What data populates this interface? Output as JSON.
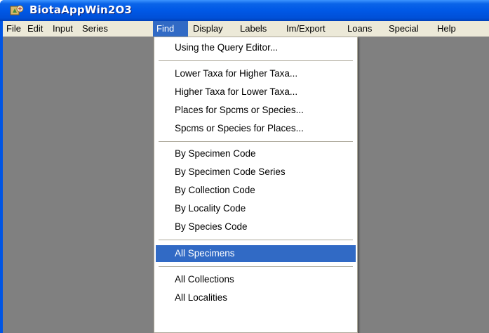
{
  "window": {
    "title": "BiotaAppWin2O3"
  },
  "menubar": {
    "items": [
      "File",
      "Edit",
      "Input",
      "Series",
      "Find",
      "Display",
      "Labels",
      "Im/Export",
      "Loans",
      "Special",
      "Help"
    ],
    "active": "Find"
  },
  "find_menu": {
    "groups": [
      [
        "Using the Query Editor..."
      ],
      [
        "Lower Taxa for Higher Taxa...",
        "Higher Taxa for Lower Taxa...",
        "Places for Spcms or Species...",
        "Spcms or Species for Places..."
      ],
      [
        "By Specimen Code",
        "By Specimen Code Series",
        "By Collection Code",
        "By Locality Code",
        "By Species Code"
      ],
      [
        "All Specimens"
      ],
      [
        "All Collections",
        "All Localities"
      ]
    ],
    "selected": "All Specimens"
  },
  "colors": {
    "titlebar": "#0058e6",
    "menubar": "#ece9d8",
    "highlight": "#316ac5",
    "client_background": "#808080"
  }
}
